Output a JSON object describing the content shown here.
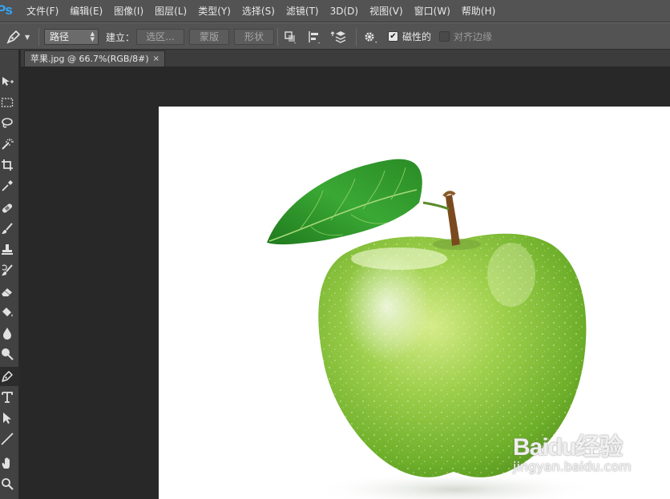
{
  "app": {
    "logo_text": "Ps"
  },
  "menu": {
    "items": [
      {
        "label": "文件(F)"
      },
      {
        "label": "编辑(E)"
      },
      {
        "label": "图像(I)"
      },
      {
        "label": "图层(L)"
      },
      {
        "label": "类型(Y)"
      },
      {
        "label": "选择(S)"
      },
      {
        "label": "滤镜(T)"
      },
      {
        "label": "3D(D)"
      },
      {
        "label": "视图(V)"
      },
      {
        "label": "窗口(W)"
      },
      {
        "label": "帮助(H)"
      }
    ]
  },
  "options_bar": {
    "tool_icon": "pen-icon",
    "mode_value": "路径",
    "build_label": "建立：",
    "selection_button": "选区...",
    "mask_button": "蒙版",
    "shape_button": "形状",
    "path_ops_icon": "path-operations-icon",
    "path_align_icon": "path-alignment-icon",
    "path_arrange_icon": "path-arrangement-icon",
    "settings_icon": "gear-icon",
    "magnetic_label": "磁性的",
    "magnetic_checked": true,
    "align_edges_label": "对齐边缘",
    "align_edges_checked": false
  },
  "document_tab": {
    "title": "苹果.jpg @ 66.7%(RGB/8#)",
    "close_glyph": "×"
  },
  "toolbar": {
    "tools": [
      {
        "name": "move-tool-icon"
      },
      {
        "name": "marquee-tool-icon"
      },
      {
        "name": "lasso-tool-icon"
      },
      {
        "name": "magic-wand-tool-icon"
      },
      {
        "name": "crop-tool-icon"
      },
      {
        "name": "eyedropper-tool-icon"
      },
      {
        "name": "healing-brush-tool-icon"
      },
      {
        "name": "brush-tool-icon"
      },
      {
        "name": "clone-stamp-tool-icon"
      },
      {
        "name": "history-brush-tool-icon"
      },
      {
        "name": "eraser-tool-icon"
      },
      {
        "name": "paint-bucket-tool-icon"
      },
      {
        "name": "blur-tool-icon"
      },
      {
        "name": "dodge-tool-icon"
      },
      {
        "name": "pen-tool-icon",
        "active": true
      },
      {
        "name": "type-tool-icon"
      },
      {
        "name": "path-selection-tool-icon"
      },
      {
        "name": "line-tool-icon"
      },
      {
        "name": "hand-tool-icon"
      },
      {
        "name": "zoom-tool-icon"
      }
    ]
  },
  "canvas": {
    "image_subject": "green-apple-photo",
    "watermark_logo": "Baidu经验",
    "watermark_url": "jingyan.baidu.com"
  },
  "colors": {
    "menubar_bg": "#535353",
    "workspace_bg": "#282828",
    "toolbar_bg": "#424242",
    "logo_blue": "#31a8ff",
    "apple_green": "#8cc63f",
    "leaf_green": "#2f9a2a"
  }
}
